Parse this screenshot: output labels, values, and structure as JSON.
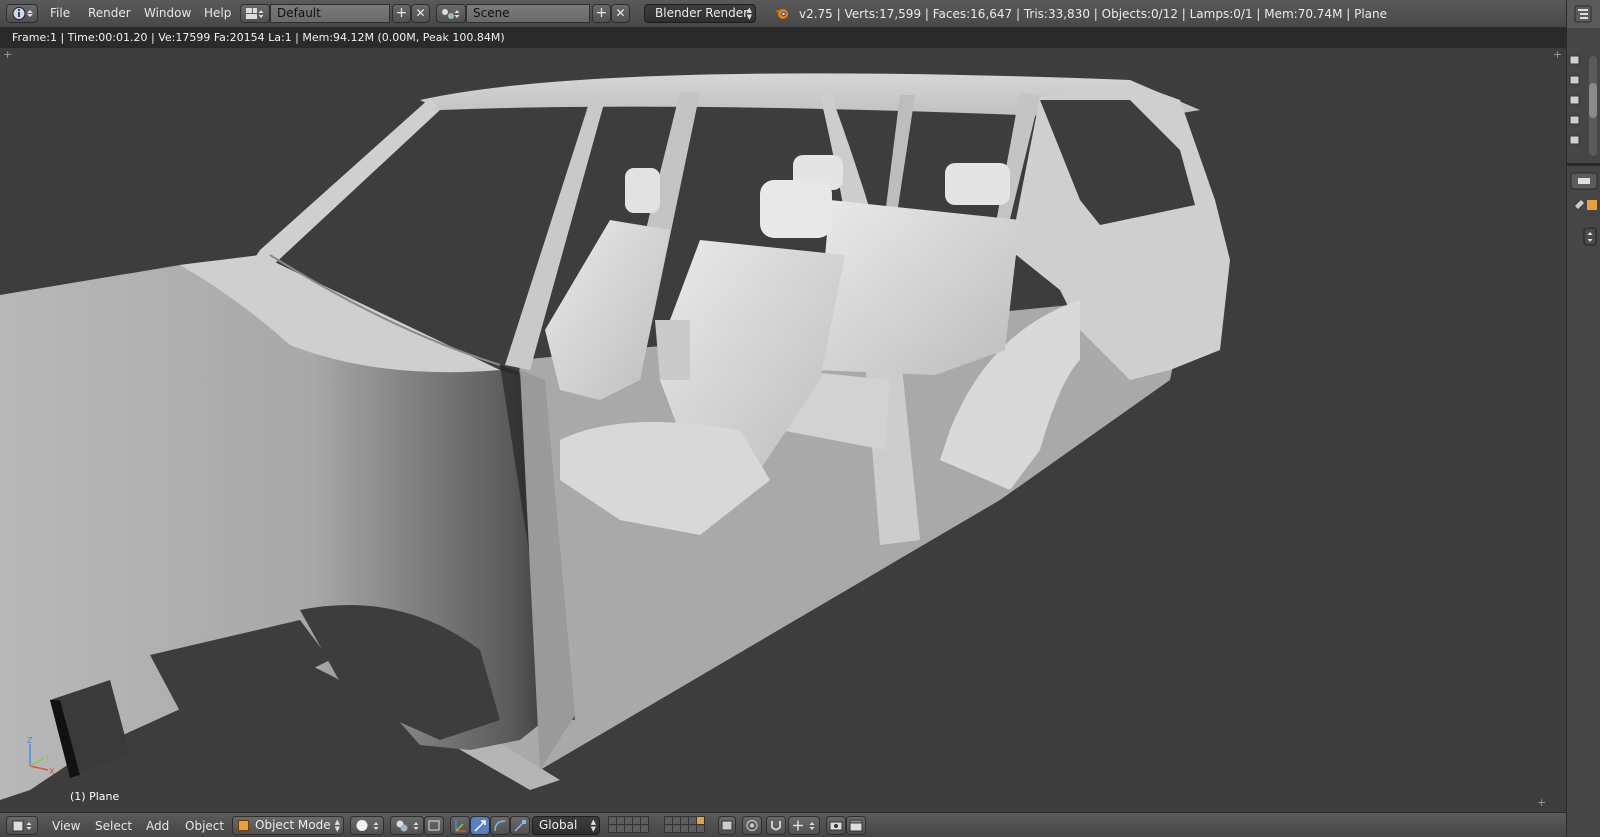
{
  "topbar": {
    "menu": [
      "File",
      "Render",
      "Window",
      "Help"
    ],
    "screen_layout": "Default",
    "scene": "Scene",
    "render_engine": "Blender Render",
    "stats": "v2.75 | Verts:17,599 | Faces:16,647 | Tris:33,830 | Objects:0/12 | Lamps:0/1 | Mem:70.74M | Plane"
  },
  "viewport": {
    "info": "Frame:1 | Time:00:01.20 | Ve:17599 Fa:20154 La:1 | Mem:94.12M (0.00M, Peak 100.84M)",
    "object_label": "(1) Plane",
    "axes": {
      "x": "X",
      "y": "Y",
      "z": "Z"
    }
  },
  "bottombar": {
    "menu": [
      "View",
      "Select",
      "Add",
      "Object"
    ],
    "mode": "Object Mode",
    "orientation": "Global"
  },
  "icons": {
    "info": "info-icon",
    "layout": "screen-layout-icon",
    "scene": "scene-icon",
    "blender": "blender-logo-icon",
    "cube": "cube-icon",
    "sphere": "sphere-shading-icon"
  },
  "colors": {
    "background": "#3d3d3d",
    "header": "#4f4f4f",
    "mesh": "#c8c8c8",
    "axis_x": "#e04a4a",
    "axis_y": "#7fcf3f",
    "axis_z": "#4a8ae0"
  }
}
